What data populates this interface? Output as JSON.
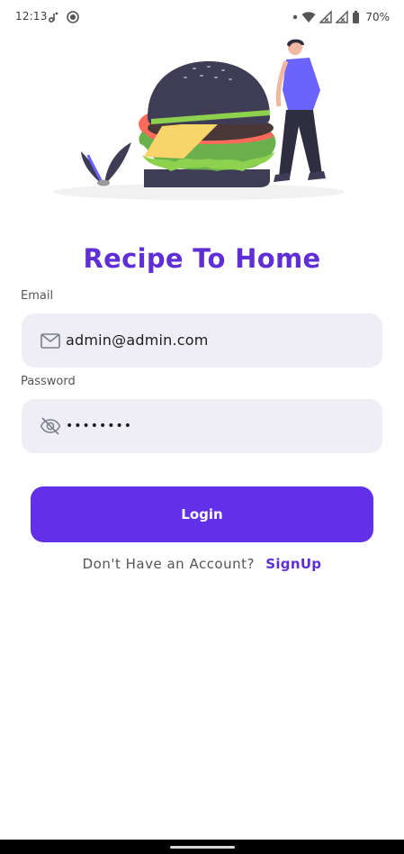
{
  "status_bar": {
    "time": "12:13",
    "battery_text": "70%",
    "icons": [
      "voicemail-icon",
      "record-icon",
      "dot-icon",
      "wifi-icon",
      "signal-icon",
      "signal-icon",
      "battery-icon"
    ]
  },
  "hero": {
    "illustration": "burger-with-person-illustration"
  },
  "app": {
    "title": "Recipe To Home"
  },
  "login_form": {
    "email_label": "Email",
    "email_value": "admin@admin.com",
    "email_icon": "mail-icon",
    "password_label": "Password",
    "password_value": "••••••••",
    "password_icon": "eye-off-icon",
    "login_label": "Login",
    "signup_prompt": "Don't Have an Account?",
    "signup_link": "SignUp"
  },
  "colors": {
    "accent": "#6130e8",
    "title": "#5f2ed6",
    "field_bg": "#eeeef4"
  }
}
